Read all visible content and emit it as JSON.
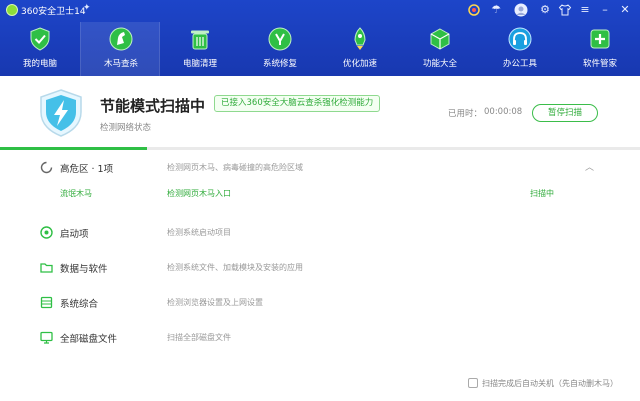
{
  "app": {
    "title": "360安全卫士14"
  },
  "nav": [
    {
      "label": "我的电脑",
      "icon": "shield-check-icon"
    },
    {
      "label": "木马查杀",
      "icon": "horse-icon"
    },
    {
      "label": "电脑清理",
      "icon": "trash-bin-icon"
    },
    {
      "label": "系统修复",
      "icon": "wrench-icon"
    },
    {
      "label": "优化加速",
      "icon": "rocket-icon"
    },
    {
      "label": "功能大全",
      "icon": "cube-icon"
    },
    {
      "label": "办公工具",
      "icon": "headphones-icon"
    },
    {
      "label": "软件管家",
      "icon": "plus-box-icon"
    }
  ],
  "banner": {
    "title": "节能模式扫描中",
    "badge": "已接入360安全大脑云查杀强化检测能力",
    "subtitle": "检测网络状态",
    "time_label": "已用时：",
    "time_value": "00:00:08",
    "pause_label": "暂停扫描",
    "progress": 0.23
  },
  "items": [
    {
      "title": "高危区 · 1项",
      "desc": "检测网页木马、病毒碰撞的高危险区域",
      "icon": "spinner-icon"
    },
    {
      "title": "启动项",
      "desc": "检测系统启动项目",
      "icon": "power-icon"
    },
    {
      "title": "数据与软件",
      "desc": "检测系统文件、加载模块及安装的应用",
      "icon": "folder-icon"
    },
    {
      "title": "系统综合",
      "desc": "检测浏览器设置及上网设置",
      "icon": "settings-grid-icon"
    },
    {
      "title": "全部磁盘文件",
      "desc": "扫描全部磁盘文件",
      "icon": "monitor-icon"
    }
  ],
  "subitem": {
    "name": "流氓木马",
    "target": "检测网页木马入口",
    "status": "扫描中"
  },
  "footer": {
    "checkbox_label": "扫描完成后自动关机（先自动删木马）"
  },
  "colors": {
    "header": "#1d45c9",
    "accent": "#2fbf45"
  }
}
